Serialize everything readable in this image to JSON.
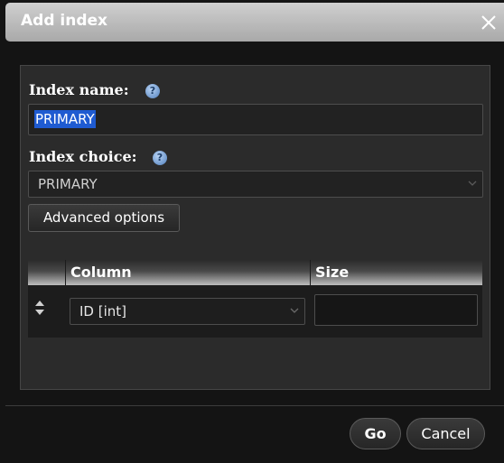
{
  "dialog": {
    "title": "Add index"
  },
  "form": {
    "index_name_label": "Index name:",
    "index_name_value": "PRIMARY",
    "index_choice_label": "Index choice:",
    "index_choice_value": "PRIMARY",
    "advanced_options_label": "Advanced options"
  },
  "table": {
    "headers": [
      "",
      "Column",
      "Size"
    ],
    "rows": [
      {
        "column": "ID [int]",
        "size": ""
      }
    ]
  },
  "footer": {
    "go_label": "Go",
    "cancel_label": "Cancel"
  },
  "icons": {
    "help": "help-icon",
    "close": "close-icon",
    "sort": "sort-arrows-icon",
    "chevron": "chevron-down-icon"
  }
}
